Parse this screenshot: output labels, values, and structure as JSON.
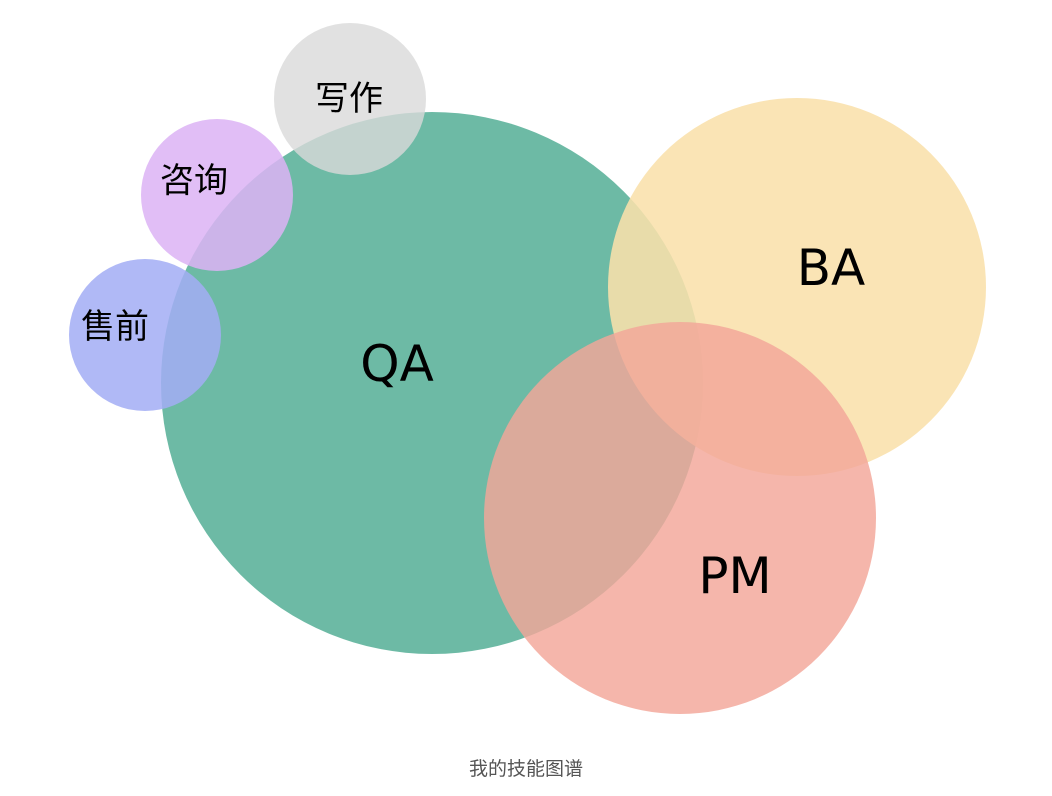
{
  "caption": "我的技能图谱",
  "bubbles": [
    {
      "id": "qa",
      "label": "QA",
      "color": "#67b7a1"
    },
    {
      "id": "ba",
      "label": "BA",
      "color": "#f9e0ab"
    },
    {
      "id": "pm",
      "label": "PM",
      "color": "#f3a699"
    },
    {
      "id": "writing",
      "label": "写作",
      "color": "#d9d9d9"
    },
    {
      "id": "consulting",
      "label": "咨询",
      "color": "#dcb3f5"
    },
    {
      "id": "presales",
      "label": "售前",
      "color": "#a3adf5"
    }
  ]
}
